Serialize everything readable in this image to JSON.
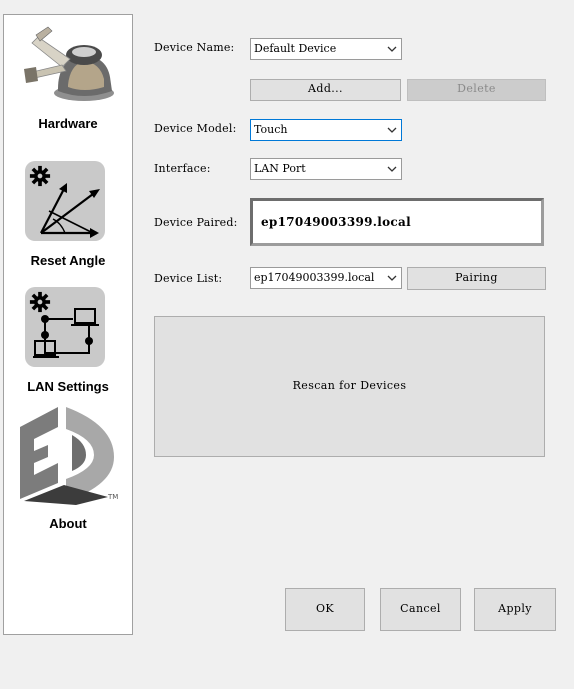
{
  "sidebar": {
    "items": [
      {
        "label": "Hardware"
      },
      {
        "label": "Reset Angle"
      },
      {
        "label": "LAN Settings"
      },
      {
        "label": "About"
      }
    ],
    "logo_tm": "TM"
  },
  "form": {
    "device_name": {
      "label": "Device Name:",
      "value": "Default Device"
    },
    "add_label": "Add...",
    "delete_label": "Delete",
    "device_model": {
      "label": "Device Model:",
      "value": "Touch"
    },
    "interface": {
      "label": "Interface:",
      "value": "LAN Port"
    },
    "device_paired": {
      "label": "Device Paired:",
      "value": "ep17049003399.local"
    },
    "device_list": {
      "label": "Device List:",
      "value": "ep17049003399.local"
    },
    "pairing_label": "Pairing",
    "rescan_label": "Rescan for Devices"
  },
  "footer": {
    "ok_label": "OK",
    "cancel_label": "Cancel",
    "apply_label": "Apply"
  },
  "colors": {
    "background": "#f0f0f0",
    "focus_border": "#0078d7",
    "tile_grey": "#c9c9c9"
  }
}
